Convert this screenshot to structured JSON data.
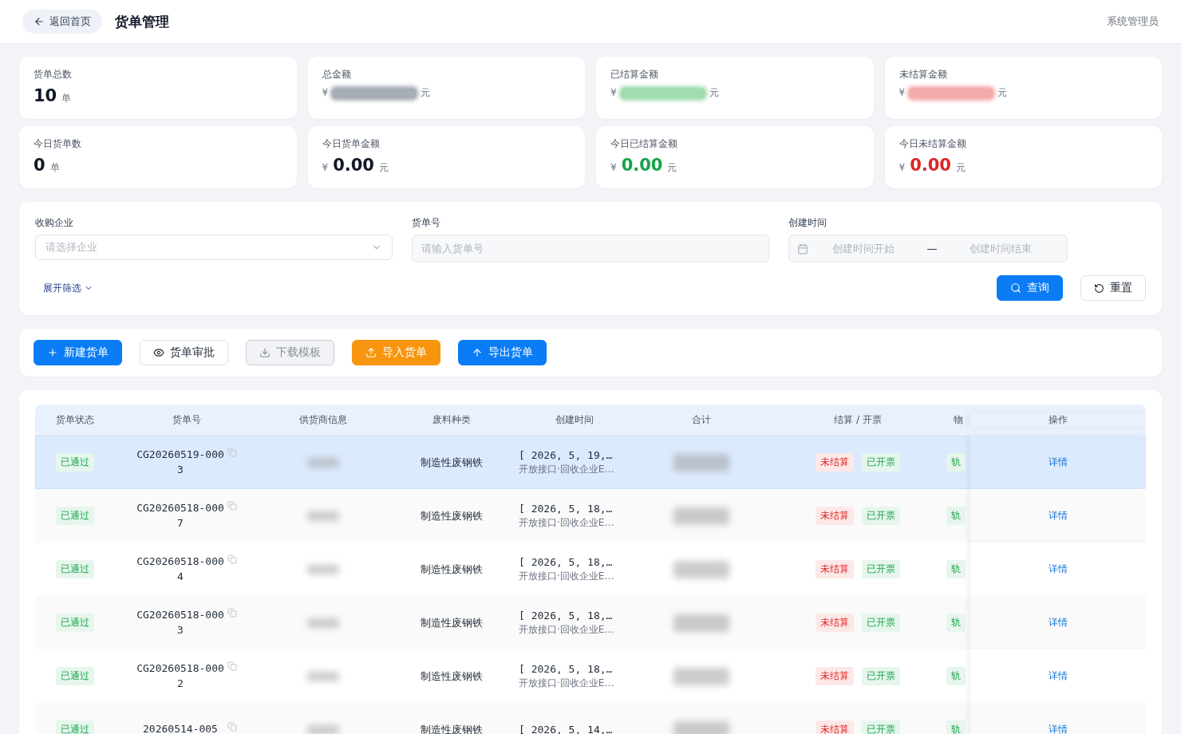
{
  "header": {
    "back_button": "返回首页",
    "title": "货单管理",
    "user": "系统管理员"
  },
  "stats": [
    {
      "label": "货单总数",
      "kind": "count",
      "value": "10",
      "unit": "单"
    },
    {
      "label": "总金额",
      "kind": "amount",
      "unit": "元",
      "color": "#a7adb6"
    },
    {
      "label": "已结算金额",
      "kind": "amount",
      "unit": "元",
      "color": "#9fdcae"
    },
    {
      "label": "未结算金额",
      "kind": "amount",
      "unit": "元",
      "color": "#f3aaaa"
    },
    {
      "label": "今日货单数",
      "kind": "count",
      "value": "0",
      "unit": "单"
    },
    {
      "label": "今日货单金额",
      "kind": "amount",
      "value": "0.00",
      "unit": "元",
      "color": "#111827"
    },
    {
      "label": "今日已结算金额",
      "kind": "amount",
      "value": "0.00",
      "unit": "元",
      "color": "#16a34a"
    },
    {
      "label": "今日未结算金额",
      "kind": "amount",
      "value": "0.00",
      "unit": "元",
      "color": "#dc2626"
    }
  ],
  "currency": "¥",
  "filters": {
    "company": {
      "label": "收购企业",
      "placeholder": "请选择企业"
    },
    "order_no": {
      "label": "货单号",
      "placeholder": "请输入货单号"
    },
    "created": {
      "label": "创建时间",
      "start_placeholder": "创建时间开始",
      "separator": "—",
      "end_placeholder": "创建时间结束"
    },
    "expand": "展开筛选",
    "query": "查询",
    "reset": "重置"
  },
  "toolbar": [
    {
      "label": "新建货单",
      "kind": "primary",
      "disabled": false
    },
    {
      "label": "货单审批",
      "kind": "default",
      "disabled": false
    },
    {
      "label": "下载模板",
      "kind": "default",
      "disabled": true
    },
    {
      "label": "导入货单",
      "kind": "warning",
      "disabled": false
    },
    {
      "label": "导出货单",
      "kind": "primary",
      "disabled": false
    }
  ],
  "table": {
    "columns": [
      "货单状态",
      "货单号",
      "供货商信息",
      "废料种类",
      "创建时间",
      "合计",
      "结算 / 开票",
      "物",
      "操作"
    ],
    "rows": [
      {
        "selected": true,
        "status": "已通过",
        "order_no": "CG20260519-0003",
        "waste": "制造性废钢铁",
        "created": "[ 2026, 5, 19,…",
        "source": "开放接口·回收企业E…",
        "settle": "未结算",
        "invoice": "已开票",
        "logistics": "轨",
        "action": "详情"
      },
      {
        "selected": false,
        "status": "已通过",
        "order_no": "CG20260518-0007",
        "waste": "制造性废钢铁",
        "created": "[ 2026, 5, 18,…",
        "source": "开放接口·回收企业E…",
        "settle": "未结算",
        "invoice": "已开票",
        "logistics": "轨",
        "action": "详情"
      },
      {
        "selected": false,
        "status": "已通过",
        "order_no": "CG20260518-0004",
        "waste": "制造性废钢铁",
        "created": "[ 2026, 5, 18,…",
        "source": "开放接口·回收企业E…",
        "settle": "未结算",
        "invoice": "已开票",
        "logistics": "轨",
        "action": "详情"
      },
      {
        "selected": false,
        "status": "已通过",
        "order_no": "CG20260518-0003",
        "waste": "制造性废钢铁",
        "created": "[ 2026, 5, 18,…",
        "source": "开放接口·回收企业E…",
        "settle": "未结算",
        "invoice": "已开票",
        "logistics": "轨",
        "action": "详情"
      },
      {
        "selected": false,
        "status": "已通过",
        "order_no": "CG20260518-0002",
        "waste": "制造性废钢铁",
        "created": "[ 2026, 5, 18,…",
        "source": "开放接口·回收企业E…",
        "settle": "未结算",
        "invoice": "已开票",
        "logistics": "轨",
        "action": "详情"
      },
      {
        "selected": false,
        "status": "已通过",
        "order_no": "20260514-005",
        "waste": "制造性废钢铁",
        "created": "[ 2026, 5, 14,…",
        "settle": "未结算",
        "invoice": "已开票",
        "logistics": "轨",
        "action": "详情"
      }
    ]
  }
}
